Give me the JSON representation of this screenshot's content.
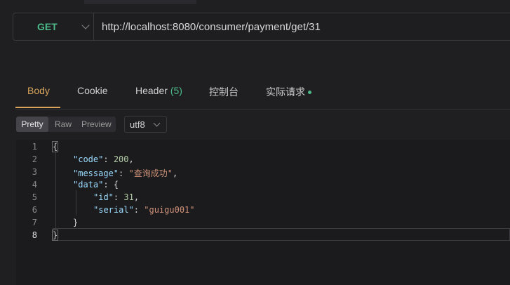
{
  "request": {
    "method": "GET",
    "url": "http://localhost:8080/consumer/payment/get/31"
  },
  "tabs": {
    "body": "Body",
    "cookie": "Cookie",
    "header": "Header",
    "header_count": "(5)",
    "console": "控制台",
    "actual_request": "实际请求"
  },
  "view_modes": {
    "pretty": "Pretty",
    "raw": "Raw",
    "preview": "Preview",
    "selected": "Pretty"
  },
  "encoding": "utf8",
  "response_lines": [
    {
      "num": "1",
      "text": "{"
    },
    {
      "num": "2",
      "text": "\"code\": 200,"
    },
    {
      "num": "3",
      "text": "\"message\": \"查询成功\","
    },
    {
      "num": "4",
      "text": "\"data\": {"
    },
    {
      "num": "5",
      "text": "\"id\": 31,"
    },
    {
      "num": "6",
      "text": "\"serial\": \"guigu001\""
    },
    {
      "num": "7",
      "text": "}"
    },
    {
      "num": "8",
      "text": "}"
    }
  ],
  "colors": {
    "accent": "#d9a35a",
    "method": "#4dbb8a",
    "json_key": "#9cdcfe",
    "json_string": "#ce9178",
    "json_number": "#b5cea8"
  },
  "icons": {
    "method_dropdown": "chevron-down-icon",
    "encoding_dropdown": "chevron-down-icon",
    "status_dot": "dot-icon"
  }
}
